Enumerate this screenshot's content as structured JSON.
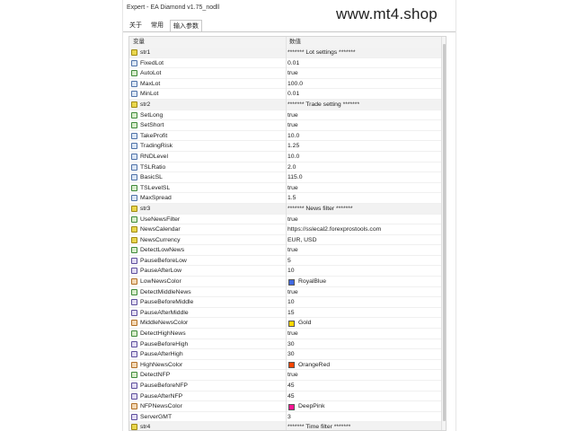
{
  "window": {
    "title": "Expert - EA Diamond v1.75_nodll"
  },
  "watermark": "www.mt4.shop",
  "tabs": [
    {
      "label": "关于",
      "active": false
    },
    {
      "label": "常用",
      "active": false
    },
    {
      "label": "输入参数",
      "active": true
    }
  ],
  "grid": {
    "headers": {
      "variable": "变量",
      "value": "数值"
    },
    "rows": [
      {
        "name": "str1",
        "value": "******* Lot settings *******",
        "icon": "string-icon",
        "type": "str"
      },
      {
        "name": "FixedLot",
        "value": "0.01",
        "icon": "double-icon",
        "type": "dv"
      },
      {
        "name": "AutoLot",
        "value": "true",
        "icon": "bool-icon",
        "type": "bl"
      },
      {
        "name": "MaxLot",
        "value": "100.0",
        "icon": "double-icon",
        "type": "dv"
      },
      {
        "name": "MinLot",
        "value": "0.01",
        "icon": "double-icon",
        "type": "dv"
      },
      {
        "name": "str2",
        "value": "******* Trade setting *******",
        "icon": "string-icon",
        "type": "str"
      },
      {
        "name": "SetLong",
        "value": "true",
        "icon": "bool-icon",
        "type": "bl"
      },
      {
        "name": "SetShort",
        "value": "true",
        "icon": "bool-icon",
        "type": "bl"
      },
      {
        "name": "TakeProfit",
        "value": "10.0",
        "icon": "double-icon",
        "type": "dv"
      },
      {
        "name": "TradingRisk",
        "value": "1.25",
        "icon": "double-icon",
        "type": "dv"
      },
      {
        "name": "RNDLevel",
        "value": "10.0",
        "icon": "double-icon",
        "type": "dv"
      },
      {
        "name": "TSLRatio",
        "value": "2.0",
        "icon": "double-icon",
        "type": "dv"
      },
      {
        "name": "BasicSL",
        "value": "115.0",
        "icon": "double-icon",
        "type": "dv"
      },
      {
        "name": "TSLevelSL",
        "value": "true",
        "icon": "bool-icon",
        "type": "bl"
      },
      {
        "name": "MaxSpread",
        "value": "1.5",
        "icon": "double-icon",
        "type": "dv"
      },
      {
        "name": "str3",
        "value": "******* News filter *******",
        "icon": "string-icon",
        "type": "str"
      },
      {
        "name": "UseNewsFilter",
        "value": "true",
        "icon": "bool-icon",
        "type": "bl"
      },
      {
        "name": "NewsCalendar",
        "value": "https://sslecal2.forexprostools.com",
        "icon": "string-icon",
        "type": "sq"
      },
      {
        "name": "NewsCurrency",
        "value": "EUR, USD",
        "icon": "string-icon",
        "type": "sq"
      },
      {
        "name": "DetectLowNews",
        "value": "true",
        "icon": "bool-icon",
        "type": "bl"
      },
      {
        "name": "PauseBeforeLow",
        "value": "5",
        "icon": "int-icon",
        "type": "in"
      },
      {
        "name": "PauseAfterLow",
        "value": "10",
        "icon": "int-icon",
        "type": "in"
      },
      {
        "name": "LowNewsColor",
        "value": "RoyalBlue",
        "icon": "color-icon",
        "type": "cl",
        "swatch": "#4169e1"
      },
      {
        "name": "DetectMiddleNews",
        "value": "true",
        "icon": "bool-icon",
        "type": "bl"
      },
      {
        "name": "PauseBeforeMiddle",
        "value": "10",
        "icon": "int-icon",
        "type": "in"
      },
      {
        "name": "PauseAfterMiddle",
        "value": "15",
        "icon": "int-icon",
        "type": "in"
      },
      {
        "name": "MiddleNewsColor",
        "value": "Gold",
        "icon": "color-icon",
        "type": "cl",
        "swatch": "#ffd700"
      },
      {
        "name": "DetectHighNews",
        "value": "true",
        "icon": "bool-icon",
        "type": "bl"
      },
      {
        "name": "PauseBeforeHigh",
        "value": "30",
        "icon": "int-icon",
        "type": "in"
      },
      {
        "name": "PauseAfterHigh",
        "value": "30",
        "icon": "int-icon",
        "type": "in"
      },
      {
        "name": "HighNewsColor",
        "value": "OrangeRed",
        "icon": "color-icon",
        "type": "cl",
        "swatch": "#ff4500"
      },
      {
        "name": "DetectNFP",
        "value": "true",
        "icon": "bool-icon",
        "type": "bl"
      },
      {
        "name": "PauseBeforeNFP",
        "value": "45",
        "icon": "int-icon",
        "type": "in"
      },
      {
        "name": "PauseAfterNFP",
        "value": "45",
        "icon": "int-icon",
        "type": "in"
      },
      {
        "name": "NFPNewsColor",
        "value": "DeepPink",
        "icon": "color-icon",
        "type": "cl",
        "swatch": "#ff1493"
      },
      {
        "name": "ServerGMT",
        "value": "3",
        "icon": "int-icon",
        "type": "in"
      },
      {
        "name": "str4",
        "value": "******* Time filter *******",
        "icon": "string-icon",
        "type": "str"
      }
    ]
  }
}
